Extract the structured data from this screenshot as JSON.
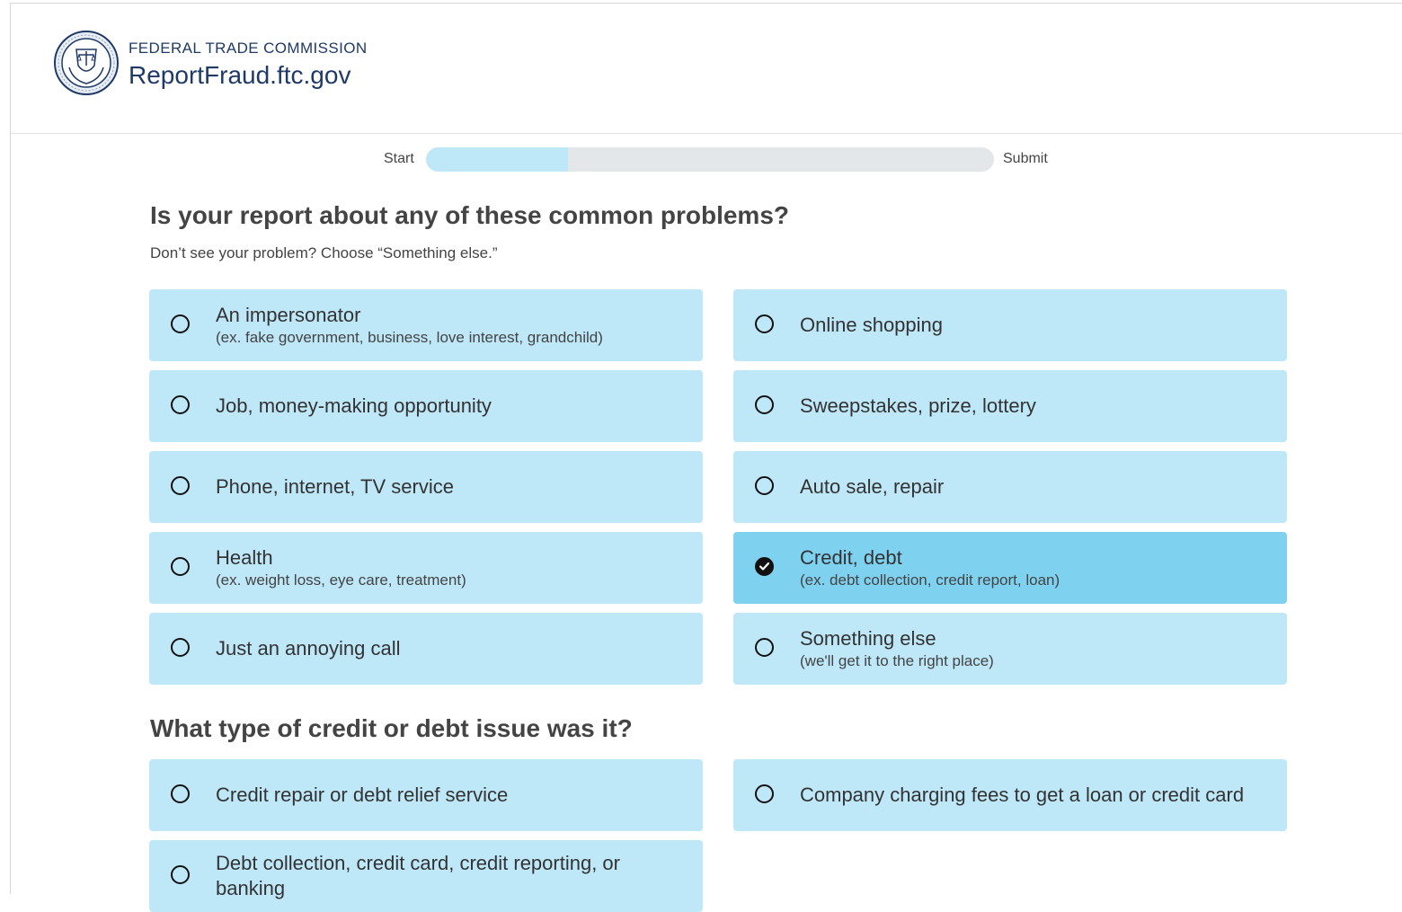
{
  "header": {
    "agency": "FEDERAL TRADE COMMISSION",
    "site": "ReportFraud.ftc.gov",
    "seal_icon": "ftc-seal-icon"
  },
  "progress": {
    "start_label": "Start",
    "end_label": "Submit",
    "fraction": 0.25
  },
  "section1": {
    "heading": "Is your report about any of these common problems?",
    "subtext": "Don’t see your problem? Choose “Something else.”",
    "options": [
      {
        "label": "An impersonator",
        "hint": "(ex. fake government, business, love interest, grandchild)",
        "selected": false
      },
      {
        "label": "Online shopping",
        "hint": "",
        "selected": false
      },
      {
        "label": "Job, money-making opportunity",
        "hint": "",
        "selected": false
      },
      {
        "label": "Sweepstakes, prize, lottery",
        "hint": "",
        "selected": false
      },
      {
        "label": "Phone, internet, TV service",
        "hint": "",
        "selected": false
      },
      {
        "label": "Auto sale, repair",
        "hint": "",
        "selected": false
      },
      {
        "label": "Health",
        "hint": "(ex. weight loss, eye care, treatment)",
        "selected": false
      },
      {
        "label": "Credit, debt",
        "hint": "(ex. debt collection, credit report, loan)",
        "selected": true
      },
      {
        "label": "Just an annoying call",
        "hint": "",
        "selected": false
      },
      {
        "label": "Something else",
        "hint": "(we'll get it to the right place)",
        "selected": false
      }
    ]
  },
  "section2": {
    "heading": "What type of credit or debt issue was it?",
    "options": [
      {
        "label": "Credit repair or debt relief service",
        "hint": "",
        "selected": false
      },
      {
        "label": "Company charging fees to get a loan or credit card",
        "hint": "",
        "selected": false
      },
      {
        "label": "Debt collection, credit card, credit reporting, or banking",
        "hint": "",
        "selected": false
      }
    ]
  },
  "colors": {
    "option_bg": "#bee7f8",
    "option_selected_bg": "#7fd1f0",
    "brand_navy": "#1f3a66"
  }
}
